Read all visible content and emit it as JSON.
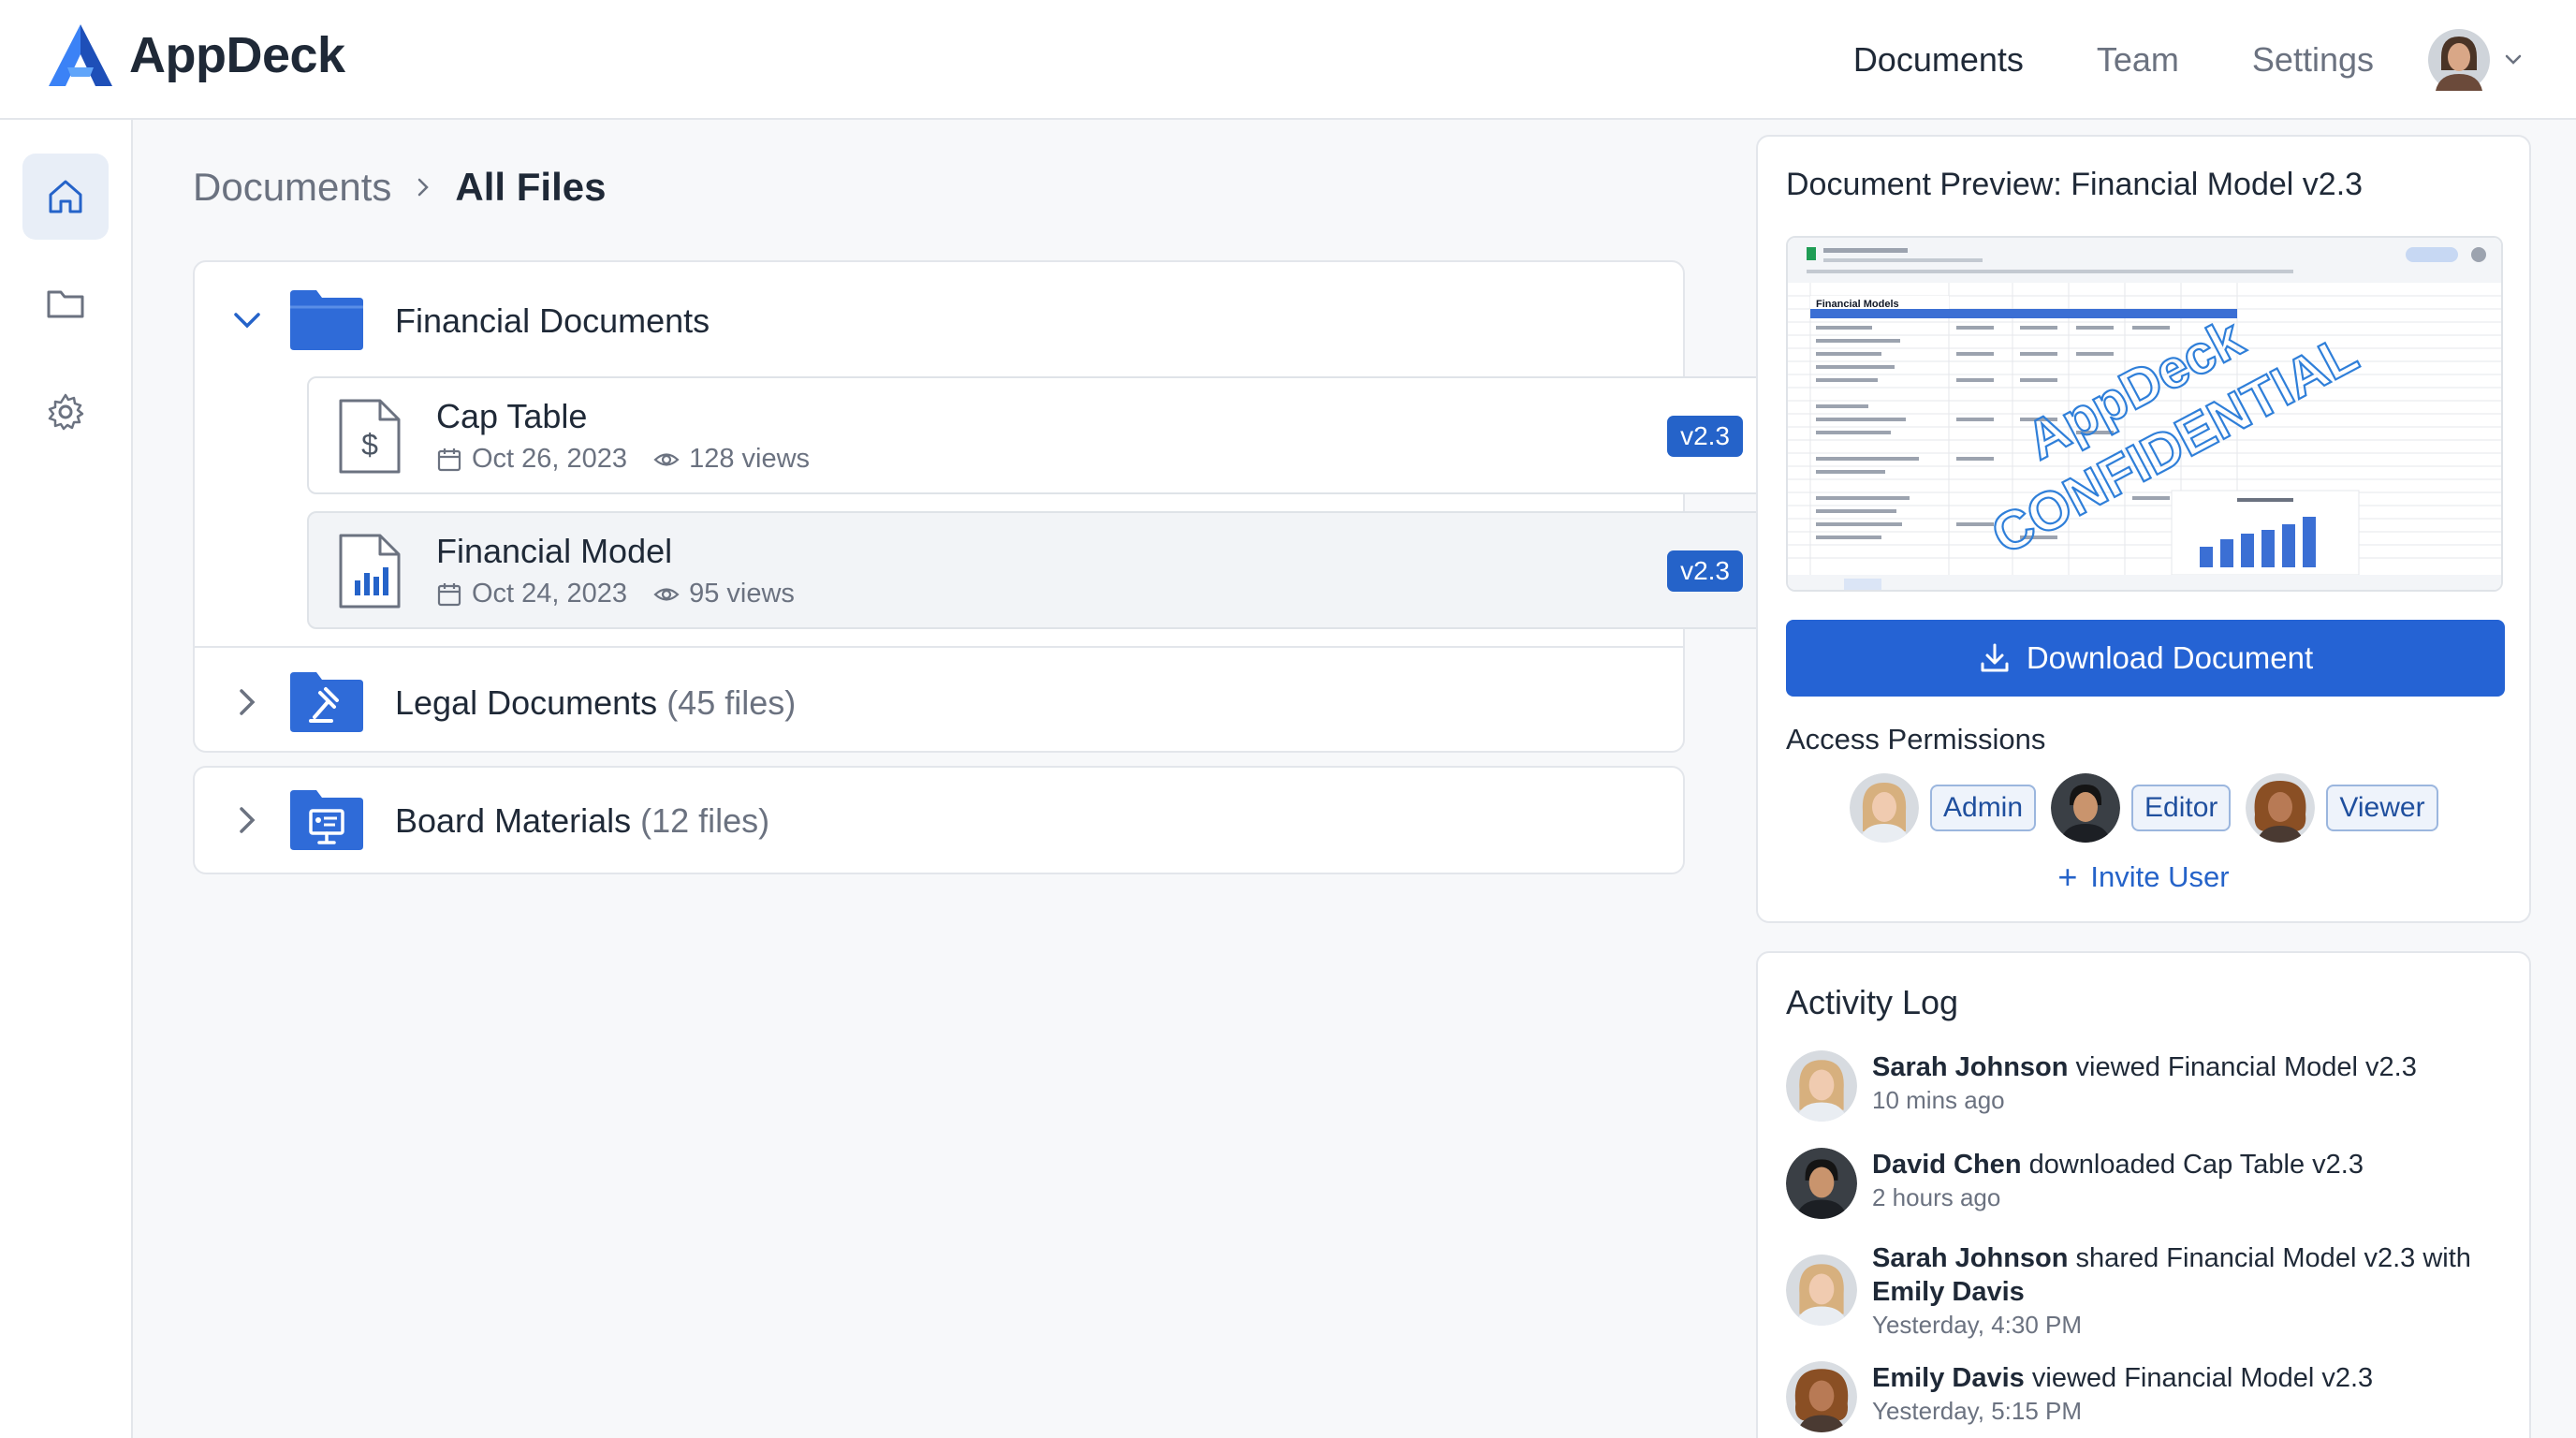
{
  "app": {
    "name": "AppDeck"
  },
  "topnav": {
    "items": [
      {
        "label": "Documents",
        "active": true
      },
      {
        "label": "Team",
        "active": false
      },
      {
        "label": "Settings",
        "active": false
      }
    ]
  },
  "sidebar": {
    "items": [
      {
        "icon": "home-icon",
        "active": true
      },
      {
        "icon": "folder-icon",
        "active": false
      },
      {
        "icon": "gear-icon",
        "active": false
      }
    ]
  },
  "breadcrumb": {
    "root": "Documents",
    "current": "All Files"
  },
  "folders": [
    {
      "name": "Financial Documents",
      "count": "",
      "expanded": true,
      "files": [
        {
          "name": "Cap Table",
          "date": "Oct 26, 2023",
          "views": "128 views",
          "version": "v2.3",
          "icon": "dollar-document-icon"
        },
        {
          "name": "Financial Model",
          "date": "Oct 24, 2023",
          "views": "95 views",
          "version": "v2.3",
          "icon": "chart-document-icon"
        }
      ]
    },
    {
      "name": "Legal Documents",
      "count": "(45 files)",
      "expanded": false
    },
    {
      "name": "Board Materials",
      "count": "(12 files)",
      "expanded": false
    }
  ],
  "preview": {
    "title": "Document Preview: Financial Model v2.3",
    "watermark_line1": "AppDeck",
    "watermark_line2": "CONFIDENTIAL",
    "sheet_heading": "Financial Models",
    "download_label": "Download Document"
  },
  "permissions": {
    "title": "Access Permissions",
    "roles": [
      "Admin",
      "Editor",
      "Viewer"
    ],
    "invite_label": "Invite User"
  },
  "activity": {
    "title": "Activity Log",
    "entries": [
      {
        "user": "Sarah Johnson",
        "action": " viewed Financial Model v2.3",
        "extra": "",
        "time": "10 mins ago"
      },
      {
        "user": "David Chen",
        "action": " downloaded Cap Table v2.3",
        "extra": "",
        "time": "2 hours ago"
      },
      {
        "user": "Sarah Johnson",
        "action": " shared Financial Model v2.3 with",
        "extra": "Emily Davis",
        "time": "Yesterday, 4:30 PM"
      },
      {
        "user": "Emily Davis",
        "action": " viewed Financial Model v2.3",
        "extra": "",
        "time": "Yesterday, 5:15 PM"
      }
    ]
  },
  "colors": {
    "accent": "#2563d4",
    "badge": "#2563c9",
    "folder": "#2f6bd8"
  }
}
